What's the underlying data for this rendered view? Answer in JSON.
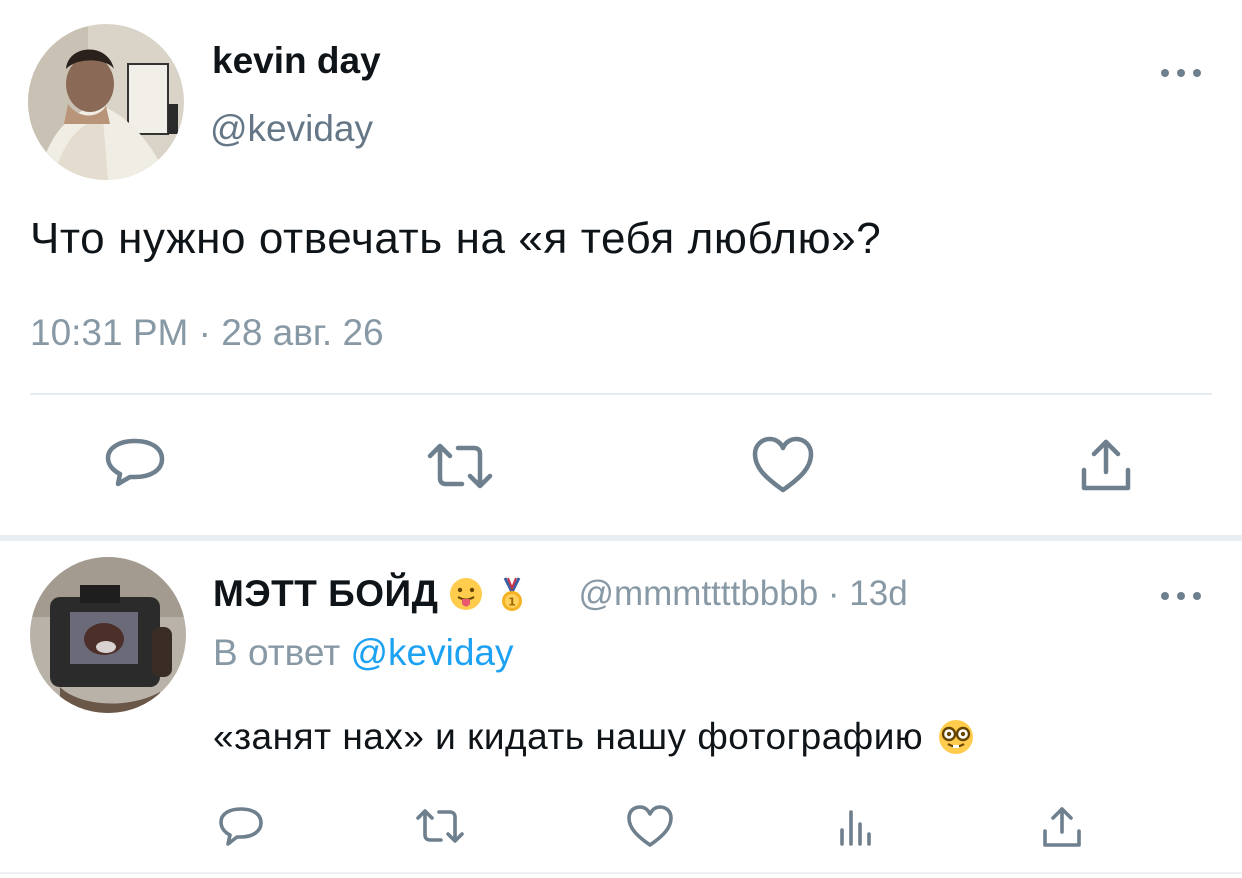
{
  "main_tweet": {
    "author_name": "kevin day",
    "author_handle": "@keviday",
    "text": "Что нужно отвечать на «я тебя люблю»?",
    "timestamp": "10:31 PM · 28 авг. 26",
    "actions": [
      "reply-icon",
      "retweet-icon",
      "like-icon",
      "share-icon"
    ],
    "more_icon": "more-dots-icon"
  },
  "reply_tweet": {
    "author_name": "МЭТТ БОЙД",
    "name_emojis": [
      "tongue-face-emoji",
      "medal-emoji"
    ],
    "author_handle": "@mmmttttbbbb · 13d",
    "reply_to_prefix": "В ответ",
    "reply_to_handle": "@keviday",
    "text": "«занят нах» и кидать нашу фотографию",
    "text_emoji": "nerd-face-emoji",
    "actions": [
      "reply-icon",
      "retweet-icon",
      "like-icon",
      "analytics-icon",
      "share-icon"
    ],
    "more_icon": "more-dots-icon"
  },
  "colors": {
    "text": "#0f1419",
    "secondary": "#8899a6",
    "link": "#1da1f2",
    "icon": "#6e7f8d",
    "divider": "#e6ecf0"
  }
}
